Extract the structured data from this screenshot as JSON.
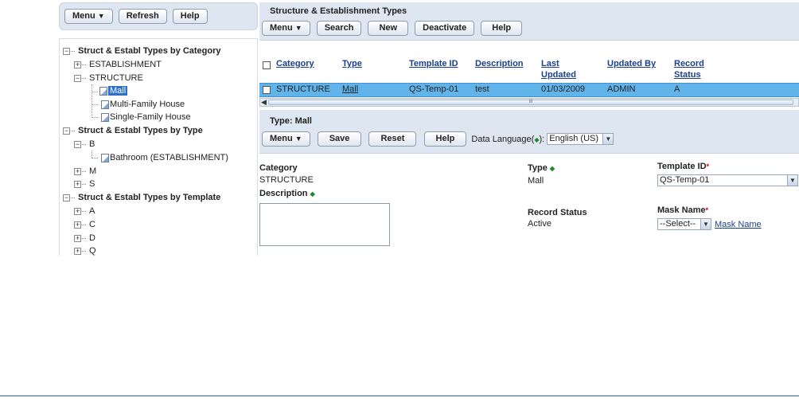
{
  "left_toolbar": {
    "menu_label": "Menu",
    "refresh_label": "Refresh",
    "help_label": "Help"
  },
  "tree": {
    "by_category": {
      "heading": "Struct & Establ Types by Category",
      "items": [
        {
          "label": "ESTABLISHMENT"
        },
        {
          "label": "STRUCTURE",
          "children": [
            "Mall",
            "Multi-Family House",
            "Single-Family House"
          ]
        }
      ]
    },
    "by_type": {
      "heading": "Struct & Establ Types by Type",
      "items": [
        {
          "label": "B",
          "children": [
            "Bathroom (ESTABLISHMENT)"
          ]
        },
        {
          "label": "M"
        },
        {
          "label": "S"
        }
      ]
    },
    "by_template": {
      "heading": "Struct & Establ Types by Template",
      "items": [
        {
          "label": "A"
        },
        {
          "label": "C"
        },
        {
          "label": "D"
        },
        {
          "label": "Q"
        }
      ]
    }
  },
  "main_header": {
    "title": "Structure & Establishment Types",
    "menu_label": "Menu",
    "search_label": "Search",
    "new_label": "New",
    "deactivate_label": "Deactivate",
    "help_label": "Help"
  },
  "grid": {
    "columns": [
      "Category",
      "Type",
      "Template ID",
      "Description",
      "Last Updated",
      "Updated By",
      "Record Status"
    ],
    "columns_wrapped": {
      "last_updated_1": "Last",
      "last_updated_2": "Updated",
      "record_status_1": "Record",
      "record_status_2": "Status"
    },
    "rows": [
      {
        "category": "STRUCTURE",
        "type": "Mall",
        "template_id": "QS-Temp-01",
        "description": "test",
        "last_updated": "01/03/2009",
        "updated_by": "ADMIN",
        "record_status": "A"
      }
    ],
    "scroll_grip": "III"
  },
  "detail": {
    "title": "Type: Mall",
    "menu_label": "Menu",
    "save_label": "Save",
    "reset_label": "Reset",
    "help_label": "Help",
    "data_language_label": "Data Language(",
    "data_language_suffix": "):",
    "data_language_value": "English (US)",
    "category_label": "Category",
    "category_value": "STRUCTURE",
    "type_label": "Type",
    "type_value": "Mall",
    "template_id_label": "Template ID",
    "template_id_value": "QS-Temp-01",
    "description_label": "Description",
    "description_value": "",
    "record_status_label": "Record Status",
    "record_status_value": "Active",
    "mask_name_label": "Mask Name",
    "mask_name_value": "--Select--",
    "mask_name_link": "Mask Name",
    "required_marker": "*"
  },
  "colors": {
    "panel_bg": "#dde6f1",
    "selected_row": "#60b4ea",
    "link": "#1b3f8f",
    "required": "#cc0000",
    "lang_indicator": "#1c8a2b"
  }
}
